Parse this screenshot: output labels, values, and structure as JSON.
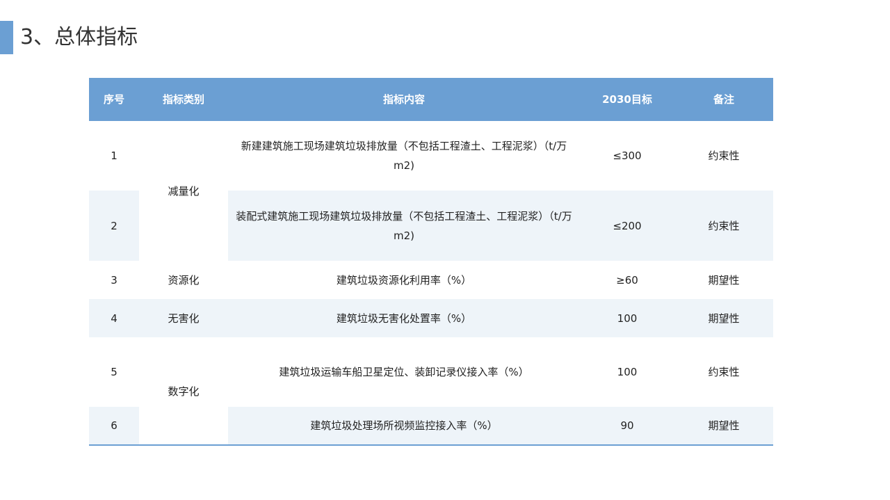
{
  "title": "3、总体指标",
  "headers": [
    "序号",
    "指标类别",
    "指标内容",
    "2030目标",
    "备注"
  ],
  "rows": [
    {
      "no": "1",
      "content": "新建建筑施工现场建筑垃圾排放量（不包括工程渣土、工程泥浆）（t/万 m2)",
      "target": "≤300",
      "note": "约束性"
    },
    {
      "no": "2",
      "content": "装配式建筑施工现场建筑垃圾排放量（不包括工程渣土、工程泥浆）（t/万 m2)",
      "target": "≤200",
      "note": "约束性"
    },
    {
      "no": "3",
      "category": "资源化",
      "content": "建筑垃圾资源化利用率（%）",
      "target": "≥60",
      "note": "期望性"
    },
    {
      "no": "4",
      "category": "无害化",
      "content": "建筑垃圾无害化处置率（%）",
      "target": "100",
      "note": "期望性"
    },
    {
      "no": "5",
      "content": "建筑垃圾运输车船卫星定位、装卸记录仪接入率（%）",
      "target": "100",
      "note": "约束性"
    },
    {
      "no": "6",
      "content": "建筑垃圾处理场所视频监控接入率（%）",
      "target": "90",
      "note": "期望性"
    }
  ],
  "merged_categories": [
    "减量化",
    "数字化"
  ]
}
